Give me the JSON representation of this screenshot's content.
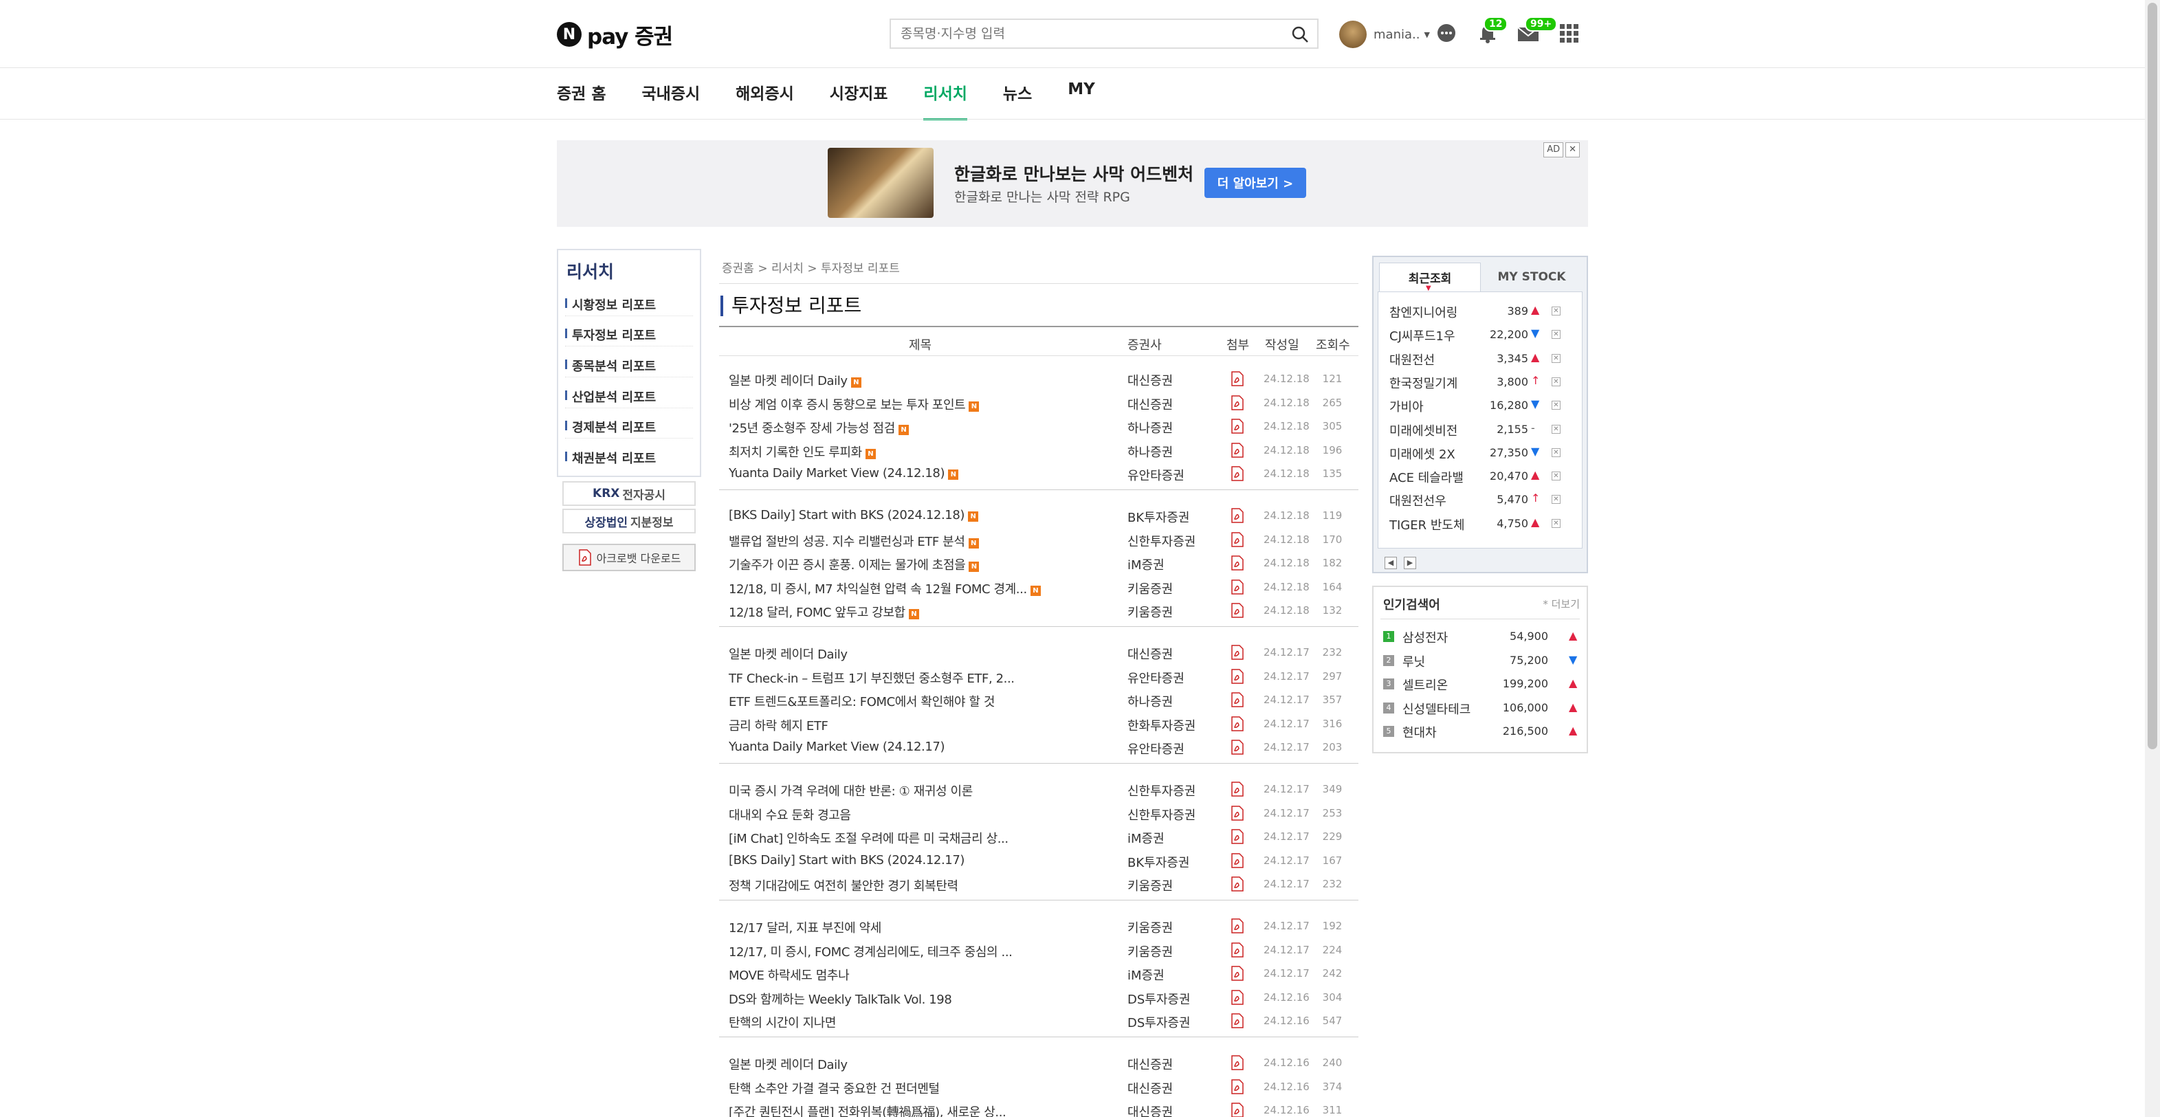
{
  "header": {
    "logo_letter": "N",
    "logo_text": "pay 증권",
    "search_placeholder": "종목명·지수명 입력",
    "username": "mania..",
    "notification_count": "12",
    "mail_count": "99+"
  },
  "nav": [
    "증권 홈",
    "국내증시",
    "해외증시",
    "시장지표",
    "리서치",
    "뉴스",
    "MY"
  ],
  "nav_active": "리서치",
  "ad": {
    "title": "한글화로 만나보는 사막 어드벤처",
    "subtitle": "한글화로 만나는 사막 전략 RPG",
    "button": "더 알아보기 >",
    "tag": "AD",
    "close": "✕"
  },
  "lnb": {
    "title": "리서치",
    "items": [
      "시황정보 리포트",
      "투자정보 리포트",
      "종목분석 리포트",
      "산업분석 리포트",
      "경제분석 리포트",
      "채권분석 리포트"
    ],
    "krx_prefix": "KRX",
    "krx": "전자공시",
    "listed_prefix": "상장법인",
    "listed": "지분정보",
    "acrobat": "아크로뱃 다운로드"
  },
  "breadcrumb": [
    "증권홈",
    "리서치",
    "투자정보 리포트"
  ],
  "page_title": "투자정보 리포트",
  "table_headers": {
    "title": "제목",
    "company": "증권사",
    "attach": "첨부",
    "date": "작성일",
    "views": "조회수"
  },
  "groups": [
    [
      {
        "title": "일본 마켓 레이더 Daily",
        "new": true,
        "company": "대신증권",
        "date": "24.12.18",
        "views": "121"
      },
      {
        "title": "비상 계엄 이후 증시 동향으로 보는 투자 포인트",
        "new": true,
        "company": "대신증권",
        "date": "24.12.18",
        "views": "265"
      },
      {
        "title": "'25년 중소형주 장세 가능성 점검",
        "new": true,
        "company": "하나증권",
        "date": "24.12.18",
        "views": "305"
      },
      {
        "title": "최저치 기록한 인도 루피화",
        "new": true,
        "company": "하나증권",
        "date": "24.12.18",
        "views": "196"
      },
      {
        "title": "Yuanta Daily Market View (24.12.18)",
        "new": true,
        "company": "유안타증권",
        "date": "24.12.18",
        "views": "135"
      }
    ],
    [
      {
        "title": "[BKS Daily] Start with BKS (2024.12.18)",
        "new": true,
        "company": "BK투자증권",
        "date": "24.12.18",
        "views": "119"
      },
      {
        "title": "밸류업 절반의 성공. 지수 리밸런싱과 ETF 분석",
        "new": true,
        "company": "신한투자증권",
        "date": "24.12.18",
        "views": "170"
      },
      {
        "title": "기술주가 이끈 증시 훈풍. 이제는 물가에 초점을",
        "new": true,
        "company": "iM증권",
        "date": "24.12.18",
        "views": "182"
      },
      {
        "title": "12/18, 미 증시, M7 차익실현 압력 속 12월 FOMC 경계...",
        "new": true,
        "company": "키움증권",
        "date": "24.12.18",
        "views": "164"
      },
      {
        "title": "12/18 달러, FOMC 앞두고 강보합",
        "new": true,
        "company": "키움증권",
        "date": "24.12.18",
        "views": "132"
      }
    ],
    [
      {
        "title": "일본 마켓 레이더 Daily",
        "new": false,
        "company": "대신증권",
        "date": "24.12.17",
        "views": "232"
      },
      {
        "title": "TF Check-in – 트럼프 1기 부진했던 중소형주 ETF, 2...",
        "new": false,
        "company": "유안타증권",
        "date": "24.12.17",
        "views": "297"
      },
      {
        "title": "ETF 트렌드&포트폴리오: FOMC에서 확인해야 할 것",
        "new": false,
        "company": "하나증권",
        "date": "24.12.17",
        "views": "357"
      },
      {
        "title": "금리 하락 헤지 ETF",
        "new": false,
        "company": "한화투자증권",
        "date": "24.12.17",
        "views": "316"
      },
      {
        "title": "Yuanta Daily Market View (24.12.17)",
        "new": false,
        "company": "유안타증권",
        "date": "24.12.17",
        "views": "203"
      }
    ],
    [
      {
        "title": "미국 증시 가격 우려에 대한 반론: ① 재귀성 이론",
        "new": false,
        "company": "신한투자증권",
        "date": "24.12.17",
        "views": "349"
      },
      {
        "title": "대내외 수요 둔화 경고음",
        "new": false,
        "company": "신한투자증권",
        "date": "24.12.17",
        "views": "253"
      },
      {
        "title": "[iM Chat] 인하속도 조절 우려에 따른 미 국채금리 상...",
        "new": false,
        "company": "iM증권",
        "date": "24.12.17",
        "views": "229"
      },
      {
        "title": "[BKS Daily] Start with BKS (2024.12.17)",
        "new": false,
        "company": "BK투자증권",
        "date": "24.12.17",
        "views": "167"
      },
      {
        "title": "정책 기대감에도 여전히 불안한 경기 회복탄력",
        "new": false,
        "company": "키움증권",
        "date": "24.12.17",
        "views": "232"
      }
    ],
    [
      {
        "title": "12/17 달러, 지표 부진에 약세",
        "new": false,
        "company": "키움증권",
        "date": "24.12.17",
        "views": "192"
      },
      {
        "title": "12/17, 미 증시, FOMC 경계심리에도, 테크주 중심의 ...",
        "new": false,
        "company": "키움증권",
        "date": "24.12.17",
        "views": "224"
      },
      {
        "title": "MOVE 하락세도 멈추나",
        "new": false,
        "company": "iM증권",
        "date": "24.12.17",
        "views": "242"
      },
      {
        "title": "DS와 함께하는 Weekly TalkTalk Vol. 198",
        "new": false,
        "company": "DS투자증권",
        "date": "24.12.16",
        "views": "304"
      },
      {
        "title": "탄핵의 시간이 지나면",
        "new": false,
        "company": "DS투자증권",
        "date": "24.12.16",
        "views": "547"
      }
    ],
    [
      {
        "title": "일본 마켓 레이더 Daily",
        "new": false,
        "company": "대신증권",
        "date": "24.12.16",
        "views": "240"
      },
      {
        "title": "탄핵 소추안 가결 결국 중요한 건 펀더멘털",
        "new": false,
        "company": "대신증권",
        "date": "24.12.16",
        "views": "374"
      },
      {
        "title": "[주간 퀀틴전시 플랜] 전화위복(轉禍爲福), 새로운 상...",
        "new": false,
        "company": "대신증권",
        "date": "24.12.16",
        "views": "311"
      }
    ]
  ],
  "right_panel": {
    "tab_recent": "최근조회",
    "tab_mystock": "MY STOCK",
    "items": [
      {
        "name": "참엔지니어링",
        "price": "389",
        "dir": "up"
      },
      {
        "name": "CJ씨푸드1우",
        "price": "22,200",
        "dir": "down"
      },
      {
        "name": "대원전선",
        "price": "3,345",
        "dir": "up"
      },
      {
        "name": "한국정밀기계",
        "price": "3,800",
        "dir": "upper"
      },
      {
        "name": "가비아",
        "price": "16,280",
        "dir": "down"
      },
      {
        "name": "미래에셋비전",
        "price": "2,155",
        "dir": "flat"
      },
      {
        "name": "미래에셋 2X",
        "price": "27,350",
        "dir": "down"
      },
      {
        "name": "ACE 테슬라밸",
        "price": "20,470",
        "dir": "up"
      },
      {
        "name": "대원전선우",
        "price": "5,470",
        "dir": "upper"
      },
      {
        "name": "TIGER 반도체",
        "price": "4,750",
        "dir": "up"
      }
    ],
    "prev": "◀",
    "next": "▶"
  },
  "popular": {
    "title": "인기검색어",
    "more": "* 더보기",
    "items": [
      {
        "rank": "1",
        "name": "삼성전자",
        "price": "54,900",
        "dir": "up"
      },
      {
        "rank": "2",
        "name": "루닛",
        "price": "75,200",
        "dir": "down"
      },
      {
        "rank": "3",
        "name": "셀트리온",
        "price": "199,200",
        "dir": "up"
      },
      {
        "rank": "4",
        "name": "신성델타테크",
        "price": "106,000",
        "dir": "up"
      },
      {
        "rank": "5",
        "name": "현대차",
        "price": "216,500",
        "dir": "up"
      }
    ]
  },
  "colors": {
    "accent": "#00a862",
    "up": "#e12343",
    "down": "#1a73e8",
    "ad_button": "#3b7de9",
    "lnb_title": "#2a3a6a"
  }
}
